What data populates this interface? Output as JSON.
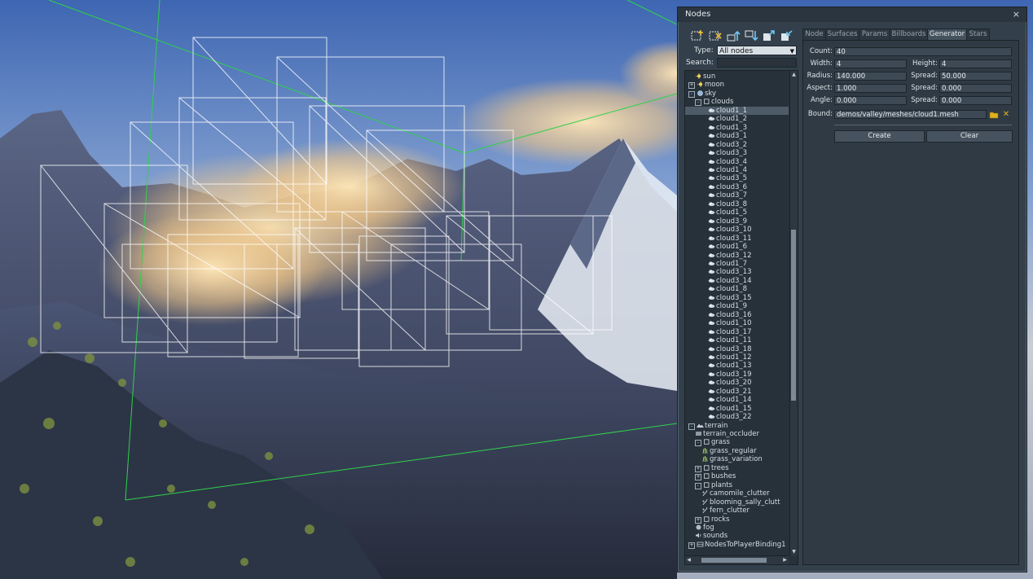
{
  "window": {
    "title": "Nodes",
    "close_glyph": "×"
  },
  "toolbar": {
    "buttons": [
      {
        "icon": "add-node-icon"
      },
      {
        "icon": "delete-node-icon"
      },
      {
        "icon": "move-up-icon"
      },
      {
        "icon": "move-down-icon"
      },
      {
        "icon": "import-node-icon"
      },
      {
        "icon": "export-node-icon"
      }
    ]
  },
  "filter": {
    "type_label": "Type:",
    "type_value": "All nodes",
    "search_label": "Search:",
    "search_value": ""
  },
  "tree": {
    "rows": [
      {
        "label": "sun",
        "indent": 1,
        "icon": "light",
        "exp": ""
      },
      {
        "label": "moon",
        "indent": 0,
        "icon": "light",
        "exp": "+"
      },
      {
        "label": "sky",
        "indent": 0,
        "icon": "sky",
        "exp": "-"
      },
      {
        "label": "clouds",
        "indent": 1,
        "icon": "box",
        "exp": "-"
      },
      {
        "label": "cloud1_1",
        "indent": 3,
        "icon": "cloud",
        "exp": "",
        "selected": true
      },
      {
        "label": "cloud1_2",
        "indent": 3,
        "icon": "cloud",
        "exp": ""
      },
      {
        "label": "cloud1_3",
        "indent": 3,
        "icon": "cloud",
        "exp": ""
      },
      {
        "label": "cloud3_1",
        "indent": 3,
        "icon": "cloud",
        "exp": ""
      },
      {
        "label": "cloud3_2",
        "indent": 3,
        "icon": "cloud",
        "exp": ""
      },
      {
        "label": "cloud3_3",
        "indent": 3,
        "icon": "cloud",
        "exp": ""
      },
      {
        "label": "cloud3_4",
        "indent": 3,
        "icon": "cloud",
        "exp": ""
      },
      {
        "label": "cloud1_4",
        "indent": 3,
        "icon": "cloud",
        "exp": ""
      },
      {
        "label": "cloud3_5",
        "indent": 3,
        "icon": "cloud",
        "exp": ""
      },
      {
        "label": "cloud3_6",
        "indent": 3,
        "icon": "cloud",
        "exp": ""
      },
      {
        "label": "cloud3_7",
        "indent": 3,
        "icon": "cloud",
        "exp": ""
      },
      {
        "label": "cloud3_8",
        "indent": 3,
        "icon": "cloud",
        "exp": ""
      },
      {
        "label": "cloud1_5",
        "indent": 3,
        "icon": "cloud",
        "exp": ""
      },
      {
        "label": "cloud3_9",
        "indent": 3,
        "icon": "cloud",
        "exp": ""
      },
      {
        "label": "cloud3_10",
        "indent": 3,
        "icon": "cloud",
        "exp": ""
      },
      {
        "label": "cloud3_11",
        "indent": 3,
        "icon": "cloud",
        "exp": ""
      },
      {
        "label": "cloud1_6",
        "indent": 3,
        "icon": "cloud",
        "exp": ""
      },
      {
        "label": "cloud3_12",
        "indent": 3,
        "icon": "cloud",
        "exp": ""
      },
      {
        "label": "cloud1_7",
        "indent": 3,
        "icon": "cloud",
        "exp": ""
      },
      {
        "label": "cloud3_13",
        "indent": 3,
        "icon": "cloud",
        "exp": ""
      },
      {
        "label": "cloud3_14",
        "indent": 3,
        "icon": "cloud",
        "exp": ""
      },
      {
        "label": "cloud1_8",
        "indent": 3,
        "icon": "cloud",
        "exp": ""
      },
      {
        "label": "cloud3_15",
        "indent": 3,
        "icon": "cloud",
        "exp": ""
      },
      {
        "label": "cloud1_9",
        "indent": 3,
        "icon": "cloud",
        "exp": ""
      },
      {
        "label": "cloud3_16",
        "indent": 3,
        "icon": "cloud",
        "exp": ""
      },
      {
        "label": "cloud1_10",
        "indent": 3,
        "icon": "cloud",
        "exp": ""
      },
      {
        "label": "cloud3_17",
        "indent": 3,
        "icon": "cloud",
        "exp": ""
      },
      {
        "label": "cloud1_11",
        "indent": 3,
        "icon": "cloud",
        "exp": ""
      },
      {
        "label": "cloud3_18",
        "indent": 3,
        "icon": "cloud",
        "exp": ""
      },
      {
        "label": "cloud1_12",
        "indent": 3,
        "icon": "cloud",
        "exp": ""
      },
      {
        "label": "cloud1_13",
        "indent": 3,
        "icon": "cloud",
        "exp": ""
      },
      {
        "label": "cloud3_19",
        "indent": 3,
        "icon": "cloud",
        "exp": ""
      },
      {
        "label": "cloud3_20",
        "indent": 3,
        "icon": "cloud",
        "exp": ""
      },
      {
        "label": "cloud3_21",
        "indent": 3,
        "icon": "cloud",
        "exp": ""
      },
      {
        "label": "cloud1_14",
        "indent": 3,
        "icon": "cloud",
        "exp": ""
      },
      {
        "label": "cloud1_15",
        "indent": 3,
        "icon": "cloud",
        "exp": ""
      },
      {
        "label": "cloud3_22",
        "indent": 3,
        "icon": "cloud",
        "exp": ""
      },
      {
        "label": "terrain",
        "indent": 0,
        "icon": "terrain",
        "exp": "-"
      },
      {
        "label": "terrain_occluder",
        "indent": 1,
        "icon": "occluder",
        "exp": ""
      },
      {
        "label": "grass",
        "indent": 1,
        "icon": "box",
        "exp": "-"
      },
      {
        "label": "grass_regular",
        "indent": 2,
        "icon": "grass",
        "exp": ""
      },
      {
        "label": "grass_variation",
        "indent": 2,
        "icon": "grass",
        "exp": ""
      },
      {
        "label": "trees",
        "indent": 1,
        "icon": "box",
        "exp": "+"
      },
      {
        "label": "bushes",
        "indent": 1,
        "icon": "box",
        "exp": "+"
      },
      {
        "label": "plants",
        "indent": 1,
        "icon": "box",
        "exp": "-"
      },
      {
        "label": "camomile_clutter",
        "indent": 2,
        "icon": "clutter",
        "exp": ""
      },
      {
        "label": "blooming_sally_clutt",
        "indent": 2,
        "icon": "clutter",
        "exp": ""
      },
      {
        "label": "fern_clutter",
        "indent": 2,
        "icon": "clutter",
        "exp": ""
      },
      {
        "label": "rocks",
        "indent": 1,
        "icon": "box",
        "exp": "+"
      },
      {
        "label": "fog",
        "indent": 1,
        "icon": "fog",
        "exp": ""
      },
      {
        "label": "sounds",
        "indent": 1,
        "icon": "sound",
        "exp": ""
      },
      {
        "label": "NodesToPlayerBinding1",
        "indent": 0,
        "icon": "binding",
        "exp": "+"
      }
    ]
  },
  "tabs": [
    {
      "label": "Node",
      "active": false
    },
    {
      "label": "Surfaces",
      "active": false
    },
    {
      "label": "Params",
      "active": false
    },
    {
      "label": "Billboards",
      "active": false
    },
    {
      "label": "Generator",
      "active": true
    },
    {
      "label": "Stars",
      "active": false
    }
  ],
  "generator": {
    "count_label": "Count:",
    "count_value": "40",
    "width_label": "Width:",
    "width_value": "4",
    "height_label": "Height:",
    "height_value": "4",
    "radius_label": "Radius:",
    "radius_value": "140.000",
    "spread1_label": "Spread:",
    "spread1_value": "50.000",
    "aspect_label": "Aspect:",
    "aspect_value": "1.000",
    "spread2_label": "Spread:",
    "spread2_value": "0.000",
    "angle_label": "Angle:",
    "angle_value": "0.000",
    "spread3_label": "Spread:",
    "spread3_value": "0.000",
    "bound_label": "Bound:",
    "bound_value": "demos/valley/meshes/cloud1.mesh",
    "create_label": "Create",
    "clear_label": "Clear"
  },
  "colors": {
    "accent_green": "#2fd24a",
    "selection_wire": "#ffffff",
    "panel_bg": "#33404c",
    "folder_icon": "#e0b020",
    "clear_icon": "#e0b020"
  }
}
